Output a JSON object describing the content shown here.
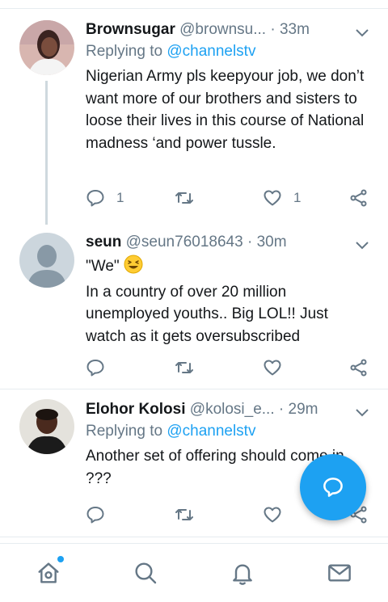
{
  "tweets": [
    {
      "name": "Brownsugar",
      "handle": "@brownsu...",
      "dot": "·",
      "time": "33m",
      "replying_prefix": "Replying to",
      "replying_to": "@channelstv",
      "text": "Nigerian Army pls keepyour job, we don’t want more of our brothers and sisters to loose their lives in this course of National madness ‘and power tussle.",
      "reply_count": "1",
      "retweet_count": "",
      "like_count": "1"
    },
    {
      "name": "seun",
      "handle": "@seun76018643",
      "dot": "·",
      "time": "30m",
      "text_line1": "\"We\"",
      "text_rest": "In a country of over 20 million unemployed youths.. Big LOL!! Just watch as it gets oversubscribed",
      "reply_count": "",
      "retweet_count": "",
      "like_count": ""
    },
    {
      "name": "Elohor Kolosi",
      "handle": "@kolosi_e...",
      "dot": "·",
      "time": "29m",
      "replying_prefix": "Replying to",
      "replying_to": "@channelstv",
      "text": "Another set of offering should come in ???",
      "reply_count": "",
      "retweet_count": "",
      "like_count": ""
    }
  ],
  "fab": {
    "icon": "compose-reply-icon"
  },
  "bottom_nav": [
    {
      "icon": "home-icon",
      "has_notification_dot": true
    },
    {
      "icon": "search-icon"
    },
    {
      "icon": "bell-icon"
    },
    {
      "icon": "mail-icon"
    }
  ],
  "colors": {
    "accent": "#1da1f2",
    "muted": "#657786",
    "text": "#14171a",
    "divider": "#e6ecf0"
  }
}
